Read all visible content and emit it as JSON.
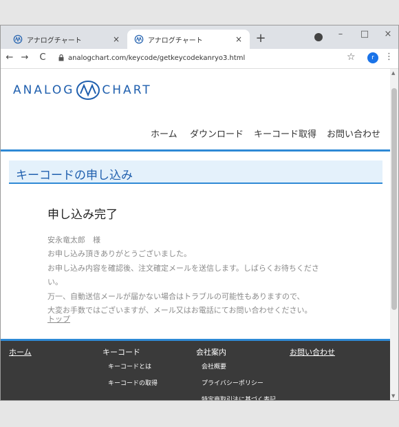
{
  "browser": {
    "tabs": [
      {
        "title": "アナログチャート"
      },
      {
        "title": "アナログチャート"
      }
    ],
    "new_tab": "+",
    "window_controls": {
      "minimize": "–",
      "maximize": "□",
      "close": "×"
    },
    "nav": {
      "back": "←",
      "forward": "→",
      "reload": "C"
    },
    "url": "analogchart.com/keycode/getkeycodekanryo3.html",
    "avatar_letter": "r",
    "star": "☆",
    "menu": "⋮",
    "close_glyph": "×"
  },
  "site": {
    "logo": {
      "left": "ANALOG",
      "right": "CHART"
    },
    "nav": {
      "home": "ホーム",
      "download": "ダウンロード",
      "keycode": "キーコード取得",
      "contact": "お問い合わせ"
    },
    "section_title": "キーコードの申し込み",
    "heading": "申し込み完了",
    "messages": [
      "安永竜太郎　様",
      "お申し込み頂きありがとうございました。",
      "お申し込み内容を確認後、注文確定メールを送信します。しばらくお待ちくださ",
      "い。",
      "万一、自動送信メールが届かない場合はトラブルの可能性もありますので、",
      "大変お手数ではございますが、メール又はお電話にてお問い合わせください。"
    ],
    "top_link": "トップ",
    "footer": {
      "home": "ホーム",
      "keycode": "キーコード",
      "keycode_items": [
        "キーコードとは",
        "キーコードの取得"
      ],
      "company": "会社案内",
      "company_items": [
        "会社概要",
        "プライバシーポリシー",
        "特定商取引法に基づく表記"
      ],
      "contact": "お問い合わせ"
    }
  },
  "colors": {
    "accent": "#2e89d5",
    "logo": "#1f5fae",
    "footer_bg": "#3a3a3a",
    "section_bg": "#e4f1fb"
  }
}
